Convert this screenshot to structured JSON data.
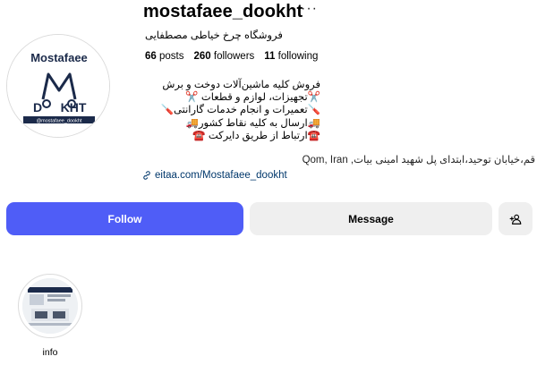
{
  "profile": {
    "username": "mostafaee_dookht",
    "more_icon": "ellipsis-icon",
    "full_name": "فروشگاه چرخ خیاطی مصطفایی",
    "avatar_logo": {
      "top_text": "Mostafaee",
      "d_letter": "D",
      "scissors_letter": "M",
      "kht": "KHT",
      "handle_band": "@mostafaee_dookht"
    },
    "stats": {
      "posts_count": "66",
      "posts_label": "posts",
      "followers_count": "260",
      "followers_label": "followers",
      "following_count": "11",
      "following_label": "following"
    },
    "bio": [
      "فروش کلیه ماشین‌آلات دوخت و برش",
      "✂️تجهیزات، لوازم و قطعات ✂️",
      "🪛تعمیرات و انجام خدمات گارانتی🪛",
      "🚚ارسال به کلیه نقاط کشور🚚",
      "☎️ارتباط از طریق دایرکت ☎️"
    ],
    "location": "قم،خیابان توحید،ابتدای پل شهید امینی بیات, Qom, Iran",
    "link": "eitaa.com/Mostafaee_dookht"
  },
  "actions": {
    "follow_label": "Follow",
    "message_label": "Message",
    "add_icon": "person-add-icon"
  },
  "highlights": [
    {
      "label": "info"
    }
  ],
  "colors": {
    "follow_button": "#4f5df7",
    "secondary_button": "#efefef",
    "link": "#00376b",
    "logo_navy": "#1b2a4a"
  }
}
